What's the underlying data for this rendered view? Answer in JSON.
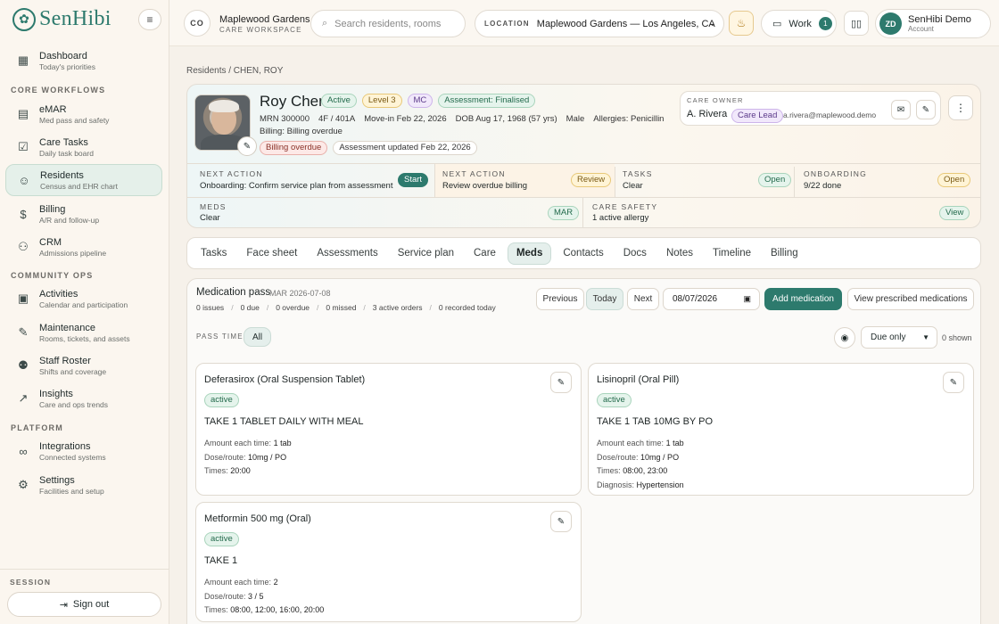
{
  "brand": {
    "name": "SenHibi"
  },
  "sidebar": {
    "sections": {
      "core": "CORE WORKFLOWS",
      "community": "COMMUNITY OPS",
      "platform": "PLATFORM"
    },
    "items": [
      {
        "label": "Dashboard",
        "sub": "Today's priorities",
        "icon": "grid-icon"
      },
      {
        "label": "eMAR",
        "sub": "Med pass and safety",
        "icon": "clipboard-icon"
      },
      {
        "label": "Care Tasks",
        "sub": "Daily task board",
        "icon": "checklist-icon"
      },
      {
        "label": "Residents",
        "sub": "Census and EHR chart",
        "icon": "user-icon"
      },
      {
        "label": "Billing",
        "sub": "A/R and follow-up",
        "icon": "dollar-icon"
      },
      {
        "label": "CRM",
        "sub": "Admissions pipeline",
        "icon": "users-icon"
      },
      {
        "label": "Activities",
        "sub": "Calendar and participation",
        "icon": "calendar-icon"
      },
      {
        "label": "Maintenance",
        "sub": "Rooms, tickets, and assets",
        "icon": "wrench-icon"
      },
      {
        "label": "Staff Roster",
        "sub": "Shifts and coverage",
        "icon": "people-icon"
      },
      {
        "label": "Insights",
        "sub": "Care and ops trends",
        "icon": "chart-icon"
      },
      {
        "label": "Integrations",
        "sub": "Connected systems",
        "icon": "link-icon"
      },
      {
        "label": "Settings",
        "sub": "Facilities and setup",
        "icon": "gear-icon"
      }
    ],
    "session_label": "SESSION",
    "signout": "Sign out"
  },
  "topbar": {
    "ws_initials": "CO",
    "ws_name": "Maplewood Gardens",
    "ws_sub": "CARE WORKSPACE",
    "search_placeholder": "Search residents, rooms",
    "location_label": "LOCATION",
    "location_value": "Maplewood Gardens — Los Angeles, CA",
    "work_label": "Work",
    "work_count": "1",
    "account_initials": "ZD",
    "account_name": "SenHibi Demo",
    "account_sub": "Account"
  },
  "breadcrumb": "Residents / CHEN, ROY",
  "resident": {
    "name": "Roy Chen",
    "tags": [
      "Active",
      "Level 3",
      "MC",
      "Assessment: Finalised"
    ],
    "mrn": "MRN 300000",
    "room": "4F / 401A",
    "move_in": "Move-in Feb 22, 2026",
    "dob": "DOB Aug 17, 1968 (57 yrs)",
    "sex": "Male",
    "allergies": "Allergies: Penicillin",
    "billing": "Billing: Billing overdue",
    "badge_billing": "Billing overdue",
    "badge_assessment": "Assessment updated Feb 22, 2026"
  },
  "owner": {
    "label": "CARE OWNER",
    "name": "A. Rivera",
    "role": "Care Lead",
    "email": "a.rivera@maplewood.demo"
  },
  "stats": [
    {
      "key": "NEXT ACTION",
      "value": "Onboarding: Confirm service plan from assessment",
      "action": "Start"
    },
    {
      "key": "NEXT ACTION",
      "value": "Review overdue billing",
      "action": "Review"
    },
    {
      "key": "TASKS",
      "value": "Clear",
      "action": "Open"
    },
    {
      "key": "ONBOARDING",
      "value": "9/22 done",
      "action": "Open"
    },
    {
      "key": "MEDS",
      "value": "Clear",
      "action": "MAR"
    },
    {
      "key": "CARE SAFETY",
      "value": "1 active allergy",
      "action": "View"
    }
  ],
  "tabs": [
    "Tasks",
    "Face sheet",
    "Assessments",
    "Service plan",
    "Care",
    "Meds",
    "Contacts",
    "Docs",
    "Notes",
    "Timeline",
    "Billing"
  ],
  "medpass": {
    "title": "Medication pass",
    "subtitle": "MAR 2026-07-08",
    "stats": [
      "0 issues",
      "0 due",
      "0 overdue",
      "0 missed",
      "3 active orders",
      "0 recorded today"
    ],
    "btn_previous": "Previous",
    "btn_today": "Today",
    "btn_next": "Next",
    "date": "08/07/2026",
    "btn_add": "Add medication",
    "btn_view": "View prescribed medications",
    "pass_time_label": "PASS TIME",
    "pass_time_value": "All",
    "filter_value": "Due only",
    "shown": "0 shown"
  },
  "medications": [
    {
      "name": "Deferasirox (Oral Suspension Tablet)",
      "status": "active",
      "instruction": "TAKE 1 TABLET DAILY WITH MEAL",
      "amount": "1 tab",
      "dose": "10mg / PO",
      "times": "20:00",
      "diagnosis": ""
    },
    {
      "name": "Lisinopril (Oral Pill)",
      "status": "active",
      "instruction": "TAKE 1 TAB 10MG BY PO",
      "amount": "1 tab",
      "dose": "10mg / PO",
      "times": "08:00, 23:00",
      "diagnosis": "Hypertension"
    },
    {
      "name": "Metformin 500 mg (Oral)",
      "status": "active",
      "instruction": "TAKE 1",
      "amount": "2",
      "dose": "3 / 5",
      "times": "08:00, 12:00, 16:00, 20:00",
      "diagnosis": ""
    }
  ],
  "labels": {
    "amount": "Amount each time:",
    "dose": "Dose/route:",
    "times": "Times:",
    "diagnosis": "Diagnosis:"
  }
}
